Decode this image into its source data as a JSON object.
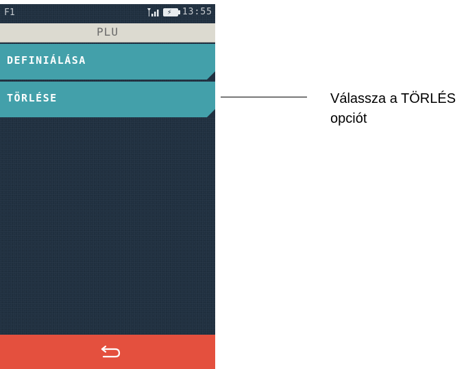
{
  "status_bar": {
    "left_label": "F1",
    "time": "13:55",
    "icons": [
      "signal-icon",
      "battery-charging-icon"
    ]
  },
  "title": "PLU",
  "menu": {
    "items": [
      {
        "label": "DEFINIÁLÁSA"
      },
      {
        "label": "TÖRLÉSE"
      }
    ]
  },
  "back_button": {
    "icon": "return-arrow-icon",
    "color": "#e4503e"
  },
  "annotation": {
    "line1": "Válassza a TÖRLÉS",
    "line2": "opciót"
  },
  "colors": {
    "screen_background": "#203040",
    "menu_item": "#43a0aa",
    "title_bar": "#dcdad0",
    "back_bar": "#e4503e"
  }
}
